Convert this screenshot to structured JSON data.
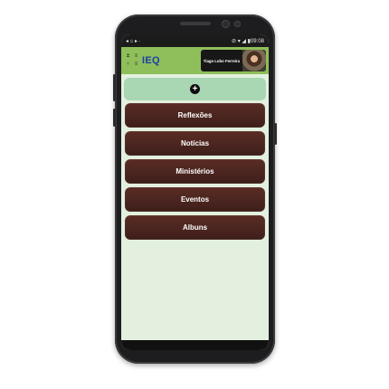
{
  "status": {
    "left_icons": "◂ ⌂ ▸ ·",
    "right_text": "⊘ ▾ ◢ ▮09:08"
  },
  "header": {
    "logo_symbols": [
      "±",
      "≡",
      "♀",
      "≡"
    ],
    "logo_text": "IEQ",
    "user_name": "Tiago Lobo Ferreira"
  },
  "add_button": {
    "icon": "+"
  },
  "menu": {
    "items": [
      {
        "label": "Reflexões"
      },
      {
        "label": "Notícias"
      },
      {
        "label": "Ministérios"
      },
      {
        "label": "Eventos"
      },
      {
        "label": "Albuns"
      }
    ]
  },
  "colors": {
    "header": "#8fbf5a",
    "add_bar": "#a9d6b3",
    "menu_item": "#4b2520",
    "screen_bg": "#e3f0df"
  }
}
